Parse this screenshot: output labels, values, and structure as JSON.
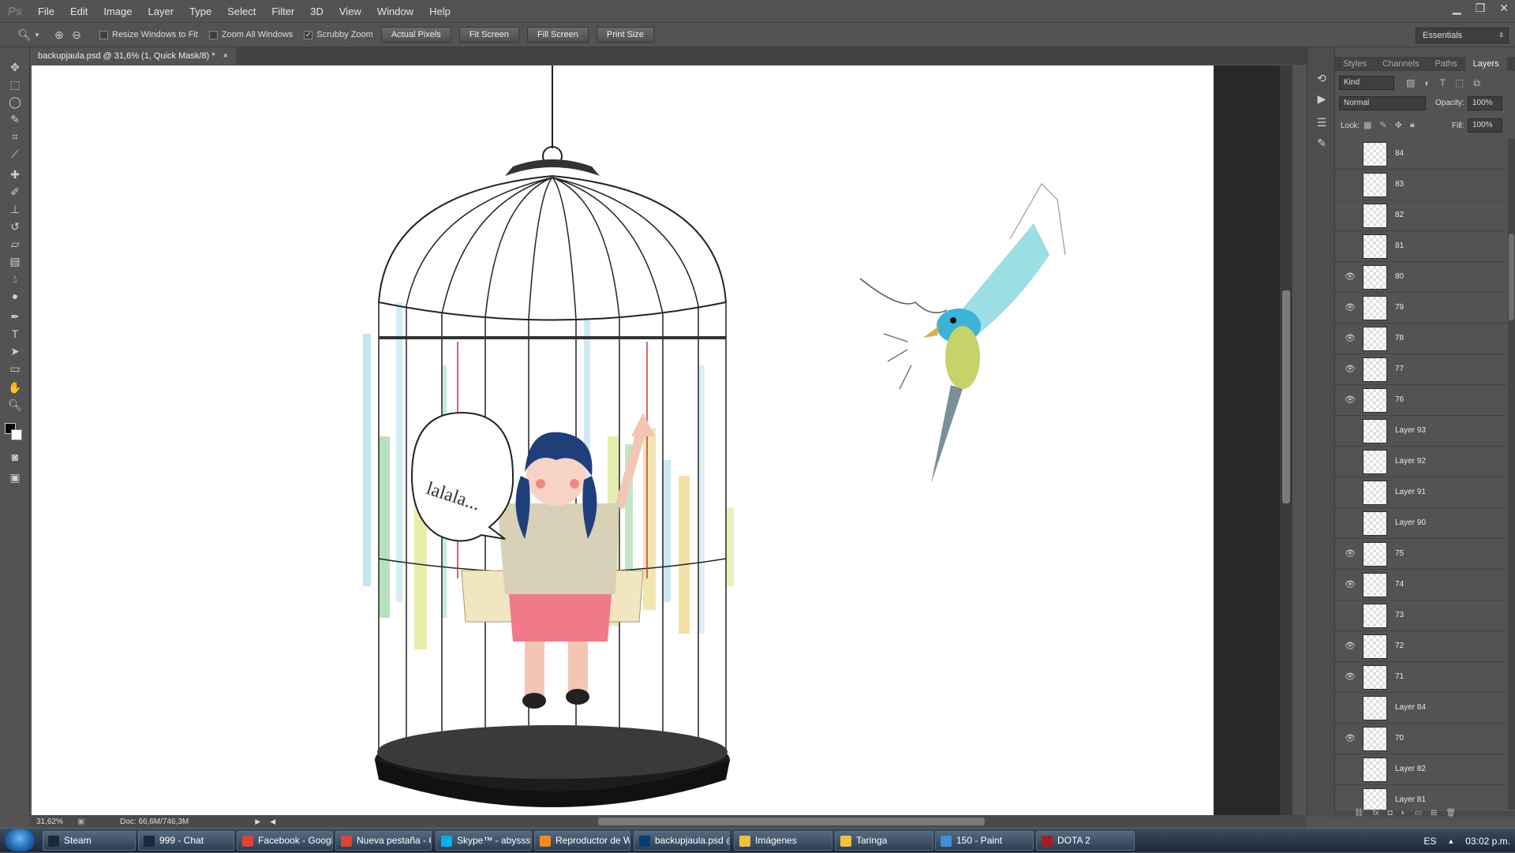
{
  "app": {
    "menu": [
      "File",
      "Edit",
      "Image",
      "Layer",
      "Type",
      "Select",
      "Filter",
      "3D",
      "View",
      "Window",
      "Help"
    ]
  },
  "options": {
    "resize_windows": {
      "label": "Resize Windows to Fit",
      "checked": false
    },
    "zoom_all": {
      "label": "Zoom All Windows",
      "checked": false
    },
    "scrubby_zoom": {
      "label": "Scrubby Zoom",
      "checked": true
    },
    "buttons": [
      "Actual Pixels",
      "Fit Screen",
      "Fill Screen",
      "Print Size"
    ],
    "workspace": "Essentials"
  },
  "document": {
    "tab_title": "backupjaula.psd @ 31,6% (1, Quick Mask/8) *",
    "close": "×",
    "zoom": "31,62%",
    "doc_size": "Doc: 66,6M/746,3M",
    "speech_text": "lalala..."
  },
  "panel": {
    "tabs": [
      "Styles",
      "Channels",
      "Paths",
      "Layers"
    ],
    "active_tab": "Layers",
    "filter_kind": "Kind",
    "blend_mode": "Normal",
    "opacity_label": "Opacity:",
    "opacity": "100%",
    "lock_label": "Lock:",
    "fill_label": "Fill:",
    "fill": "100%",
    "layers": [
      {
        "name": "84",
        "visible": false
      },
      {
        "name": "83",
        "visible": false
      },
      {
        "name": "82",
        "visible": false
      },
      {
        "name": "81",
        "visible": false
      },
      {
        "name": "80",
        "visible": true
      },
      {
        "name": "79",
        "visible": true
      },
      {
        "name": "78",
        "visible": true
      },
      {
        "name": "77",
        "visible": true
      },
      {
        "name": "76",
        "visible": true
      },
      {
        "name": "Layer 93",
        "visible": false
      },
      {
        "name": "Layer 92",
        "visible": false
      },
      {
        "name": "Layer 91",
        "visible": false
      },
      {
        "name": "Layer 90",
        "visible": false
      },
      {
        "name": "75",
        "visible": true
      },
      {
        "name": "74",
        "visible": true
      },
      {
        "name": "73",
        "visible": false
      },
      {
        "name": "72",
        "visible": true
      },
      {
        "name": "71",
        "visible": true
      },
      {
        "name": "Layer 84",
        "visible": false
      },
      {
        "name": "70",
        "visible": true
      },
      {
        "name": "Layer 82",
        "visible": false
      },
      {
        "name": "Layer 81",
        "visible": false
      }
    ]
  },
  "taskbar": {
    "items": [
      {
        "label": "Steam",
        "icon": "steam-icon",
        "color": "#1b2838"
      },
      {
        "label": "999 - Chat",
        "icon": "steam-chat-icon",
        "color": "#1b2838"
      },
      {
        "label": "Facebook - Google ...",
        "icon": "chrome-icon",
        "color": "#db4437"
      },
      {
        "label": "Nueva pestaña - Go...",
        "icon": "chrome-icon",
        "color": "#db4437"
      },
      {
        "label": "Skype™ - abyssstecla",
        "icon": "skype-icon",
        "color": "#00aff0"
      },
      {
        "label": "Reproductor de Wi...",
        "icon": "media-player-icon",
        "color": "#f08a24"
      },
      {
        "label": "backupjaula.psd @ ...",
        "icon": "photoshop-icon",
        "color": "#0a3d72"
      },
      {
        "label": "Imágenes",
        "icon": "folder-icon",
        "color": "#f0c040"
      },
      {
        "label": "Taringa",
        "icon": "folder-icon",
        "color": "#f0c040"
      },
      {
        "label": "150 - Paint",
        "icon": "paint-icon",
        "color": "#3f8fd6"
      },
      {
        "label": "DOTA 2",
        "icon": "dota-icon",
        "color": "#a32020"
      }
    ],
    "language": "ES",
    "time": "03:02 p.m."
  }
}
